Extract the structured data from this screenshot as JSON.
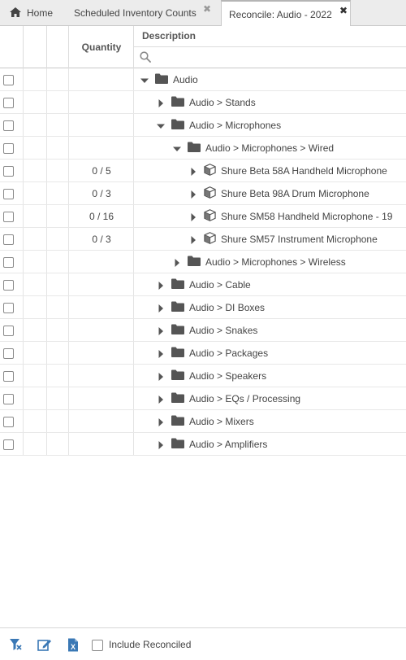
{
  "tabs": [
    {
      "label": "Home",
      "icon": "home-icon",
      "active": false,
      "closable": false
    },
    {
      "label": "Scheduled Inventory Counts",
      "active": false,
      "closable": true
    },
    {
      "label": "Reconcile: Audio - 2022",
      "active": true,
      "closable": true
    }
  ],
  "grid": {
    "columns": {
      "quantity": "Quantity",
      "description": "Description"
    },
    "filter": {
      "placeholder": "",
      "value": ""
    },
    "rows": [
      {
        "level": 0,
        "type": "folder",
        "expanded": true,
        "label": "Audio",
        "qty": ""
      },
      {
        "level": 1,
        "type": "folder",
        "expanded": false,
        "label": "Audio > Stands",
        "qty": ""
      },
      {
        "level": 1,
        "type": "folder",
        "expanded": true,
        "label": "Audio > Microphones",
        "qty": ""
      },
      {
        "level": 2,
        "type": "folder",
        "expanded": true,
        "label": "Audio > Microphones > Wired",
        "qty": ""
      },
      {
        "level": 3,
        "type": "item",
        "expanded": false,
        "label": "Shure Beta 58A Handheld Microphone",
        "qty": "0 / 5"
      },
      {
        "level": 3,
        "type": "item",
        "expanded": false,
        "label": "Shure Beta 98A Drum Microphone",
        "qty": "0 / 3"
      },
      {
        "level": 3,
        "type": "item",
        "expanded": false,
        "label": "Shure SM58 Handheld Microphone - 19",
        "qty": "0 / 16"
      },
      {
        "level": 3,
        "type": "item",
        "expanded": false,
        "label": "Shure SM57 Instrument Microphone",
        "qty": "0 / 3"
      },
      {
        "level": 2,
        "type": "folder",
        "expanded": false,
        "label": "Audio > Microphones > Wireless",
        "qty": ""
      },
      {
        "level": 1,
        "type": "folder",
        "expanded": false,
        "label": "Audio > Cable",
        "qty": ""
      },
      {
        "level": 1,
        "type": "folder",
        "expanded": false,
        "label": "Audio > DI Boxes",
        "qty": ""
      },
      {
        "level": 1,
        "type": "folder",
        "expanded": false,
        "label": "Audio > Snakes",
        "qty": ""
      },
      {
        "level": 1,
        "type": "folder",
        "expanded": false,
        "label": "Audio > Packages",
        "qty": ""
      },
      {
        "level": 1,
        "type": "folder",
        "expanded": false,
        "label": "Audio > Speakers",
        "qty": ""
      },
      {
        "level": 1,
        "type": "folder",
        "expanded": false,
        "label": "Audio > EQs / Processing",
        "qty": ""
      },
      {
        "level": 1,
        "type": "folder",
        "expanded": false,
        "label": "Audio > Mixers",
        "qty": ""
      },
      {
        "level": 1,
        "type": "folder",
        "expanded": false,
        "label": "Audio > Amplifiers",
        "qty": ""
      }
    ]
  },
  "footer": {
    "icons": [
      "clear-filter-icon",
      "edit-icon",
      "excel-export-icon"
    ],
    "include_reconciled_label": "Include Reconciled",
    "include_reconciled_checked": false
  },
  "colors": {
    "icon_blue": "#3a78b5",
    "folder_gray": "#555555",
    "text": "#444444"
  }
}
